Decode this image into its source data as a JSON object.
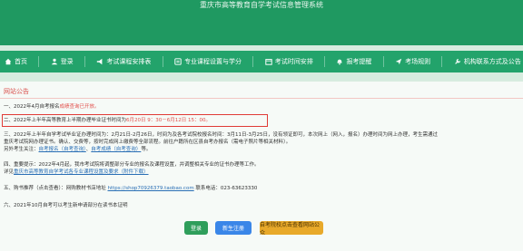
{
  "header": {
    "system_title": "重庆市高等教育自学考试信息管理系统"
  },
  "nav": {
    "items": [
      {
        "label": "首页",
        "icon": "home-icon"
      },
      {
        "label": "登录",
        "icon": "user-icon"
      },
      {
        "label": "考试课程安排表",
        "icon": "megaphone-icon"
      },
      {
        "label": "专业课程设置与学分",
        "icon": "list-icon"
      },
      {
        "label": "考试时间安排",
        "icon": "calendar-icon"
      },
      {
        "label": "报考提醒",
        "icon": "bell-icon"
      },
      {
        "label": "考场规则",
        "icon": "plane-icon"
      },
      {
        "label": "机构联系方式及公告",
        "icon": "wrench-icon"
      }
    ]
  },
  "panel": {
    "title": "网站公告",
    "notices": {
      "n1": {
        "prefix": "一、2022年4月自考报名",
        "highlight": "成绩查询已开放。"
      },
      "n2": {
        "prefix": "二、2022年上半年高等教育上半期办理毕业证书时间为",
        "highlight": "6月20日 9：30－6月12日 15：00。"
      },
      "n3": {
        "line1": "三、2022年上半年自学考试毕业证办理时间为：2月21日-2月26日，时间为及各考试院校报名时间：3月11日-3月25日，没有领证即可，本次网上（网入，报名）办理时间为网上办理，考生需通过",
        "line2": "重庆考试院网办理证书。确认、交费等，按时完成网上缴费等全部流程。前往户籍所在区县自考办报名（需电子照片等相关材料）。",
        "line3_prefix": "另外考生关注：",
        "link1": "自考报名（自考查询）",
        "mid": "、",
        "link2": "自考成绩（自考查询）",
        "tail": "等。"
      },
      "n4": {
        "line1": "四、重要提示：2022年4月起，我市考试院将调整部分专业的报名及课程设置，并调整相关专业的证书办理等工作。",
        "line2_prefix": "详见",
        "link": "重庆市高等教育自学考试各专业课程设置及要求（附件下载）",
        "tail": ""
      },
      "n5": {
        "prefix": "五、购书推荐（点击查看）：网购教材书店地址 ",
        "link": "https://shop70926379.taobao.com",
        "tail": " 联系电话：023-63623330"
      },
      "n6": {
        "text": "六、2021年10月自考可以考生新申请部分在读书本证明"
      }
    }
  },
  "buttons": {
    "login": "登录",
    "register": "新生注册",
    "scan": "自考院校点击查看网站公众"
  },
  "colors": {
    "topbar": "#1f9961",
    "navbar": "#23a36b",
    "panel_bg": "#f6faf7",
    "title_red": "#d9534f",
    "box_red": "#e03b36",
    "btn_green": "#2f9e5b",
    "btn_blue": "#3a86e8",
    "btn_yellow": "#e8a92a"
  }
}
